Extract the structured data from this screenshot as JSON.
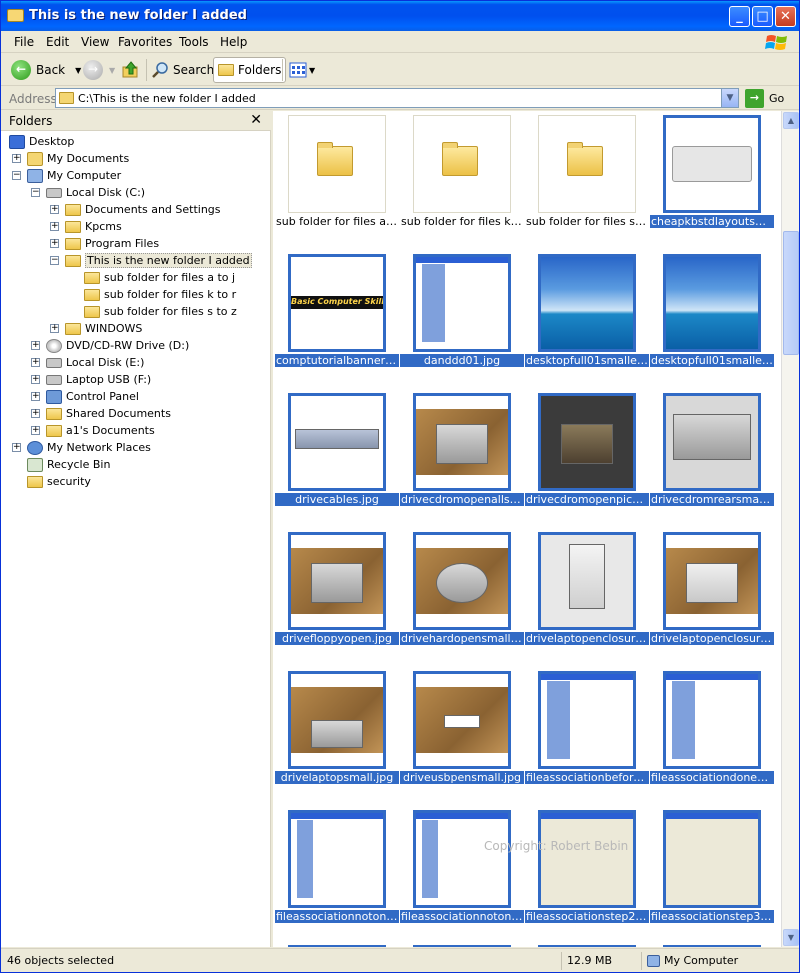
{
  "window": {
    "title": "This is the new folder I added"
  },
  "menu": {
    "items": [
      "File",
      "Edit",
      "View",
      "Favorites",
      "Tools",
      "Help"
    ]
  },
  "toolbar": {
    "back_label": "Back",
    "search_label": "Search",
    "folders_label": "Folders"
  },
  "address": {
    "label": "Address",
    "value": "C:\\This is the new folder I added",
    "go_label": "Go"
  },
  "folders_pane": {
    "title": "Folders",
    "tree": [
      {
        "label": "Desktop"
      },
      {
        "label": "My Documents"
      },
      {
        "label": "My Computer"
      },
      {
        "label": "Local Disk (C:)"
      },
      {
        "label": "Documents and Settings"
      },
      {
        "label": "Kpcms"
      },
      {
        "label": "Program Files"
      },
      {
        "label": "This is the new folder I added"
      },
      {
        "label": "sub folder for files a to j"
      },
      {
        "label": "sub folder for files k to r"
      },
      {
        "label": "sub folder for files s to z"
      },
      {
        "label": "WINDOWS"
      },
      {
        "label": "DVD/CD-RW Drive (D:)"
      },
      {
        "label": "Local Disk (E:)"
      },
      {
        "label": "Laptop USB (F:)"
      },
      {
        "label": "Control Panel"
      },
      {
        "label": "Shared Documents"
      },
      {
        "label": "a1's Documents"
      },
      {
        "label": "My Network Places"
      },
      {
        "label": "Recycle Bin"
      },
      {
        "label": "security"
      }
    ]
  },
  "files": [
    {
      "name": "sub folder for files a to j"
    },
    {
      "name": "sub folder for files k to r"
    },
    {
      "name": "sub folder for files s to z"
    },
    {
      "name": "cheapkbstdlayoutsmal..."
    },
    {
      "name": "comptutorialbanner01..."
    },
    {
      "name": "danddd01.jpg"
    },
    {
      "name": "desktopfull01smaller.gif"
    },
    {
      "name": "desktopfull01smaller.jpg"
    },
    {
      "name": "drivecables.jpg"
    },
    {
      "name": "drivecdromopenallsm..."
    },
    {
      "name": "drivecdromopenpickup..."
    },
    {
      "name": "drivecdromrearsmall.jpg"
    },
    {
      "name": "drivefloppyopen.jpg"
    },
    {
      "name": "drivehardopensmall.jpg"
    },
    {
      "name": "drivelaptopenclosurep..."
    },
    {
      "name": "drivelaptopenclosures..."
    },
    {
      "name": "drivelaptopsmall.jpg"
    },
    {
      "name": "driveusbpensmall.jpg"
    },
    {
      "name": "fileassociationbeforew..."
    },
    {
      "name": "fileassociationdonesm..."
    },
    {
      "name": "fileassociationnotonlis..."
    },
    {
      "name": "fileassociationnotonlis..."
    },
    {
      "name": "fileassociationstep2.jpg"
    },
    {
      "name": "fileassociationstep3.jpg"
    }
  ],
  "thumb_text": {
    "banner": "Basic Computer Skills"
  },
  "watermark": "Copyright: Robert Bebin",
  "status": {
    "selected": "46 objects selected",
    "size": "12.9 MB",
    "location": "My Computer"
  },
  "colors": {
    "selection": "#316ac5",
    "titlebar": "#0053ee"
  }
}
